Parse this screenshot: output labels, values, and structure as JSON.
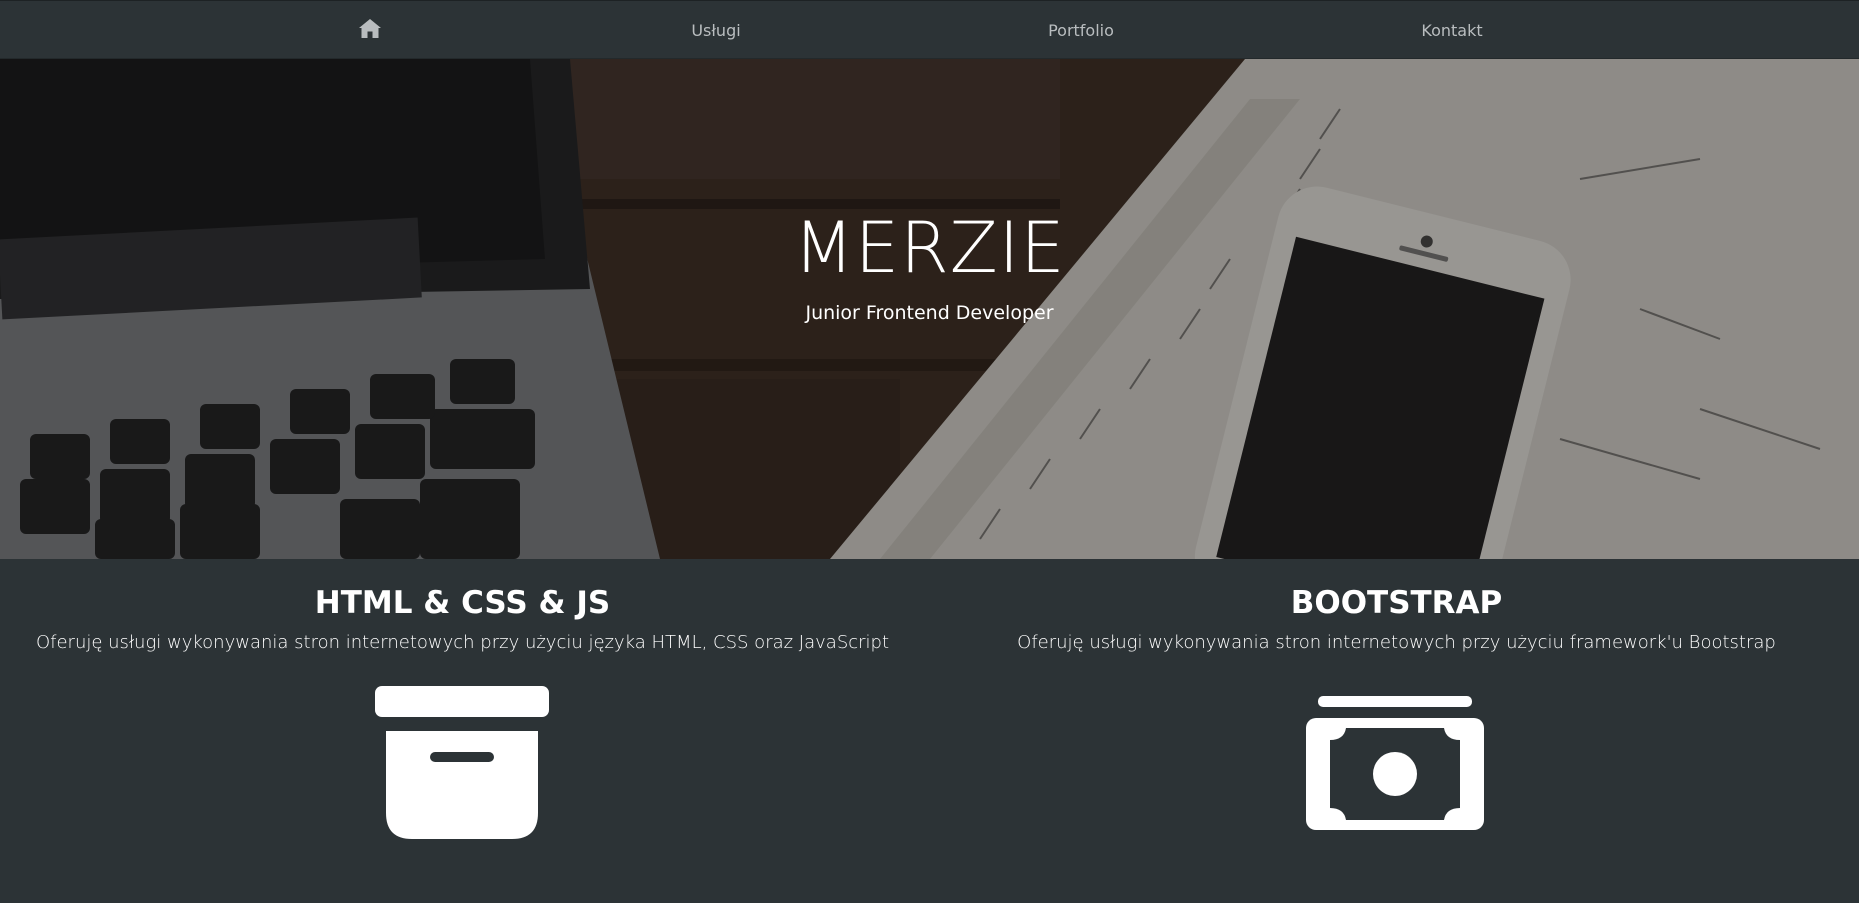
{
  "nav": {
    "home_icon": "home-icon",
    "items": [
      {
        "label": "Usługi"
      },
      {
        "label": "Portfolio"
      },
      {
        "label": "Kontakt"
      }
    ]
  },
  "hero": {
    "title": "MERZIE",
    "subtitle": "Junior Frontend Developer"
  },
  "services": [
    {
      "title": "HTML & CSS & JS",
      "description": "Oferuję usługi wykonywania stron internetowych przy użyciu języka HTML, CSS oraz JavaScript",
      "icon": "archive-box-icon"
    },
    {
      "title": "BOOTSTRAP",
      "description": "Oferuję usługi wykonywania stron internetowych przy użyciu framework'u Bootstrap",
      "icon": "money-bill-icon"
    }
  ],
  "colors": {
    "background": "#2c3336",
    "nav_text": "#b9bdbf",
    "text": "#ffffff"
  }
}
